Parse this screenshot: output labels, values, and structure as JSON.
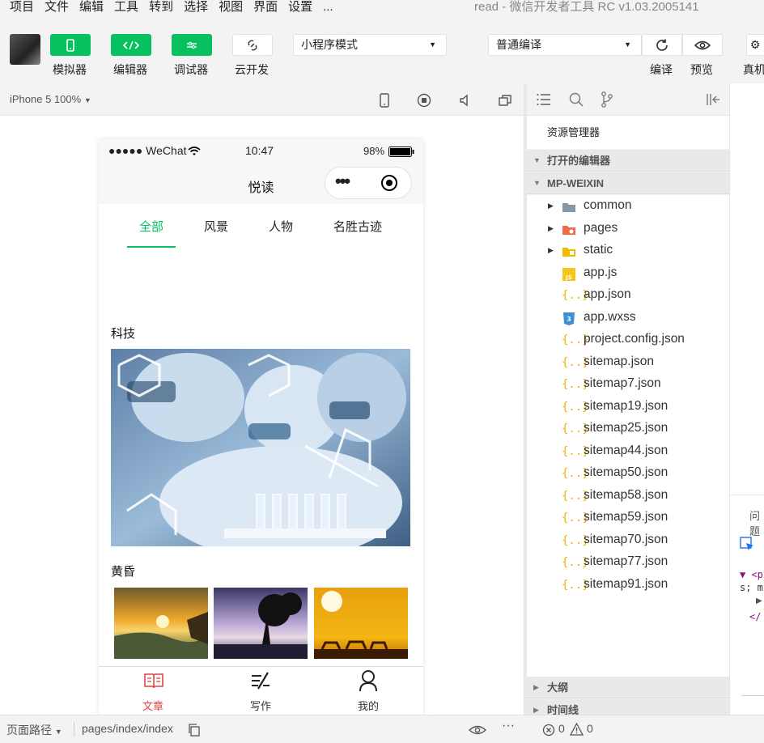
{
  "menubar": {
    "items": [
      "项目",
      "文件",
      "编辑",
      "工具",
      "转到",
      "选择",
      "视图",
      "界面",
      "设置",
      "..."
    ],
    "title": "read - 微信开发者工具 RC v1.03.2005141"
  },
  "toolbar": {
    "simulator_label": "模拟器",
    "editor_label": "编辑器",
    "debugger_label": "调试器",
    "cloud_label": "云开发",
    "mode_select": "小程序模式",
    "compile_select": "普通编译",
    "compile_label": "编译",
    "preview_label": "预览",
    "realdevice_label": "真机"
  },
  "simulator": {
    "device": "iPhone 5 100%",
    "statusbar": {
      "signal": "●●●●● WeChat",
      "time": "10:47",
      "battery": "98%"
    },
    "nav_title": "悦读",
    "capsule_dots": "•••",
    "tabs": [
      "全部",
      "风景",
      "人物",
      "名胜古迹"
    ],
    "sections": [
      "科技",
      "黄昏"
    ],
    "tabbar": [
      "文章",
      "写作",
      "我的"
    ]
  },
  "explorer": {
    "title": "资源管理器",
    "open_editors": "打开的编辑器",
    "project": "MP-WEIXIN",
    "folders": [
      "common",
      "pages",
      "static"
    ],
    "files": [
      "app.js",
      "app.json",
      "app.wxss",
      "project.config.json",
      "sitemap.json",
      "sitemap7.json",
      "sitemap19.json",
      "sitemap25.json",
      "sitemap44.json",
      "sitemap50.json",
      "sitemap58.json",
      "sitemap59.json",
      "sitemap70.json",
      "sitemap77.json",
      "sitemap91.json"
    ],
    "outline": "大纲",
    "timeline": "时间线"
  },
  "rightpanel": {
    "issues_tab": "问题",
    "code_line1": "▼ <p",
    "code_line2": "s; m",
    "code_line3": "▶",
    "code_line4": "</"
  },
  "statusbar": {
    "page_path_label": "页面路径",
    "page_path": "pages/index/index",
    "errors": "0",
    "warnings": "0"
  },
  "colors": {
    "accent": "#07c160",
    "tabbar_active": "#e64340"
  }
}
